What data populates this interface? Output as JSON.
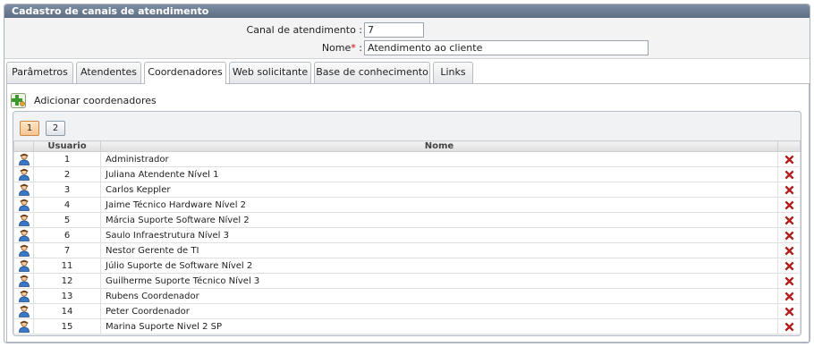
{
  "window": {
    "title": "Cadastro de canais de atendimento"
  },
  "form": {
    "canal_label": "Canal de atendimento :",
    "canal_value": "7",
    "nome_label": "Nome",
    "nome_required": "*",
    "nome_colon": ":",
    "nome_value": "Atendimento ao cliente"
  },
  "tabs": [
    {
      "label": "Parâmetros",
      "active": false
    },
    {
      "label": "Atendentes",
      "active": false
    },
    {
      "label": "Coordenadores",
      "active": true
    },
    {
      "label": "Web solicitante",
      "active": false
    },
    {
      "label": "Base de conhecimento",
      "active": false
    },
    {
      "label": "Links",
      "active": false
    }
  ],
  "panel": {
    "add_label": "Adicionar coordenadores"
  },
  "pager": {
    "pages": [
      "1",
      "2"
    ],
    "current": "1"
  },
  "table": {
    "headers": {
      "usuario": "Usuario",
      "nome": "Nome"
    },
    "rows": [
      {
        "usuario": "1",
        "nome": "Administrador"
      },
      {
        "usuario": "2",
        "nome": "Juliana Atendente Nível 1"
      },
      {
        "usuario": "3",
        "nome": "Carlos Keppler"
      },
      {
        "usuario": "4",
        "nome": "Jaime Técnico Hardware Nível 2"
      },
      {
        "usuario": "5",
        "nome": "Márcia Suporte Software Nível 2"
      },
      {
        "usuario": "6",
        "nome": "Saulo Infraestrutura Nível 3"
      },
      {
        "usuario": "7",
        "nome": "Nestor Gerente de TI"
      },
      {
        "usuario": "11",
        "nome": "Júlio Suporte de Software Nível 2"
      },
      {
        "usuario": "12",
        "nome": "Guilherme Suporte Técnico Nível 3"
      },
      {
        "usuario": "13",
        "nome": "Rubens Coordenador"
      },
      {
        "usuario": "14",
        "nome": "Peter Coordenador"
      },
      {
        "usuario": "15",
        "nome": "Marina Suporte Nivel 2 SP"
      }
    ]
  },
  "icons": {
    "user": "user-icon",
    "delete": "delete-icon",
    "add": "add-user-icon"
  },
  "colors": {
    "title_bar": "#6a7a8f",
    "delete_red": "#d0201b",
    "active_page": "#f5c48f"
  }
}
